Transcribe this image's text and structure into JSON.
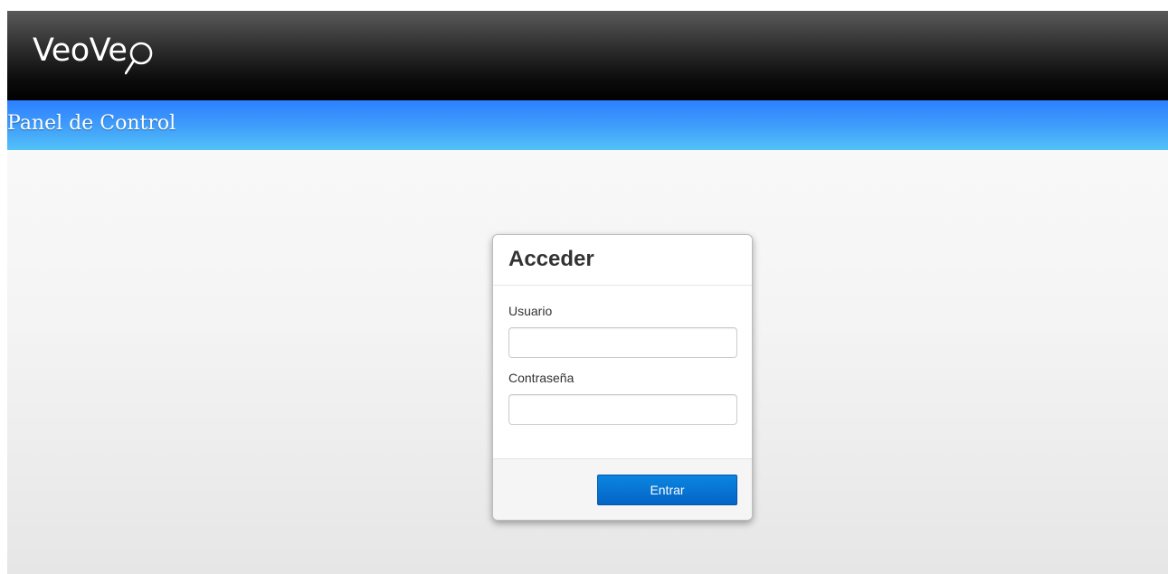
{
  "header": {
    "logo_text": "VeoVe",
    "logo_icon": "magnifier-icon",
    "subtitle": "Panel de Control"
  },
  "login": {
    "title": "Acceder",
    "username_label": "Usuario",
    "username_value": "",
    "password_label": "Contraseña",
    "password_value": "",
    "submit_label": "Entrar"
  },
  "colors": {
    "topbar": "#000000",
    "subbar_top": "#2c80ff",
    "subbar_bottom": "#52c1f7",
    "button_top": "#0a86e0",
    "button_bottom": "#0564c6",
    "page_background": "#f4f4f4"
  }
}
